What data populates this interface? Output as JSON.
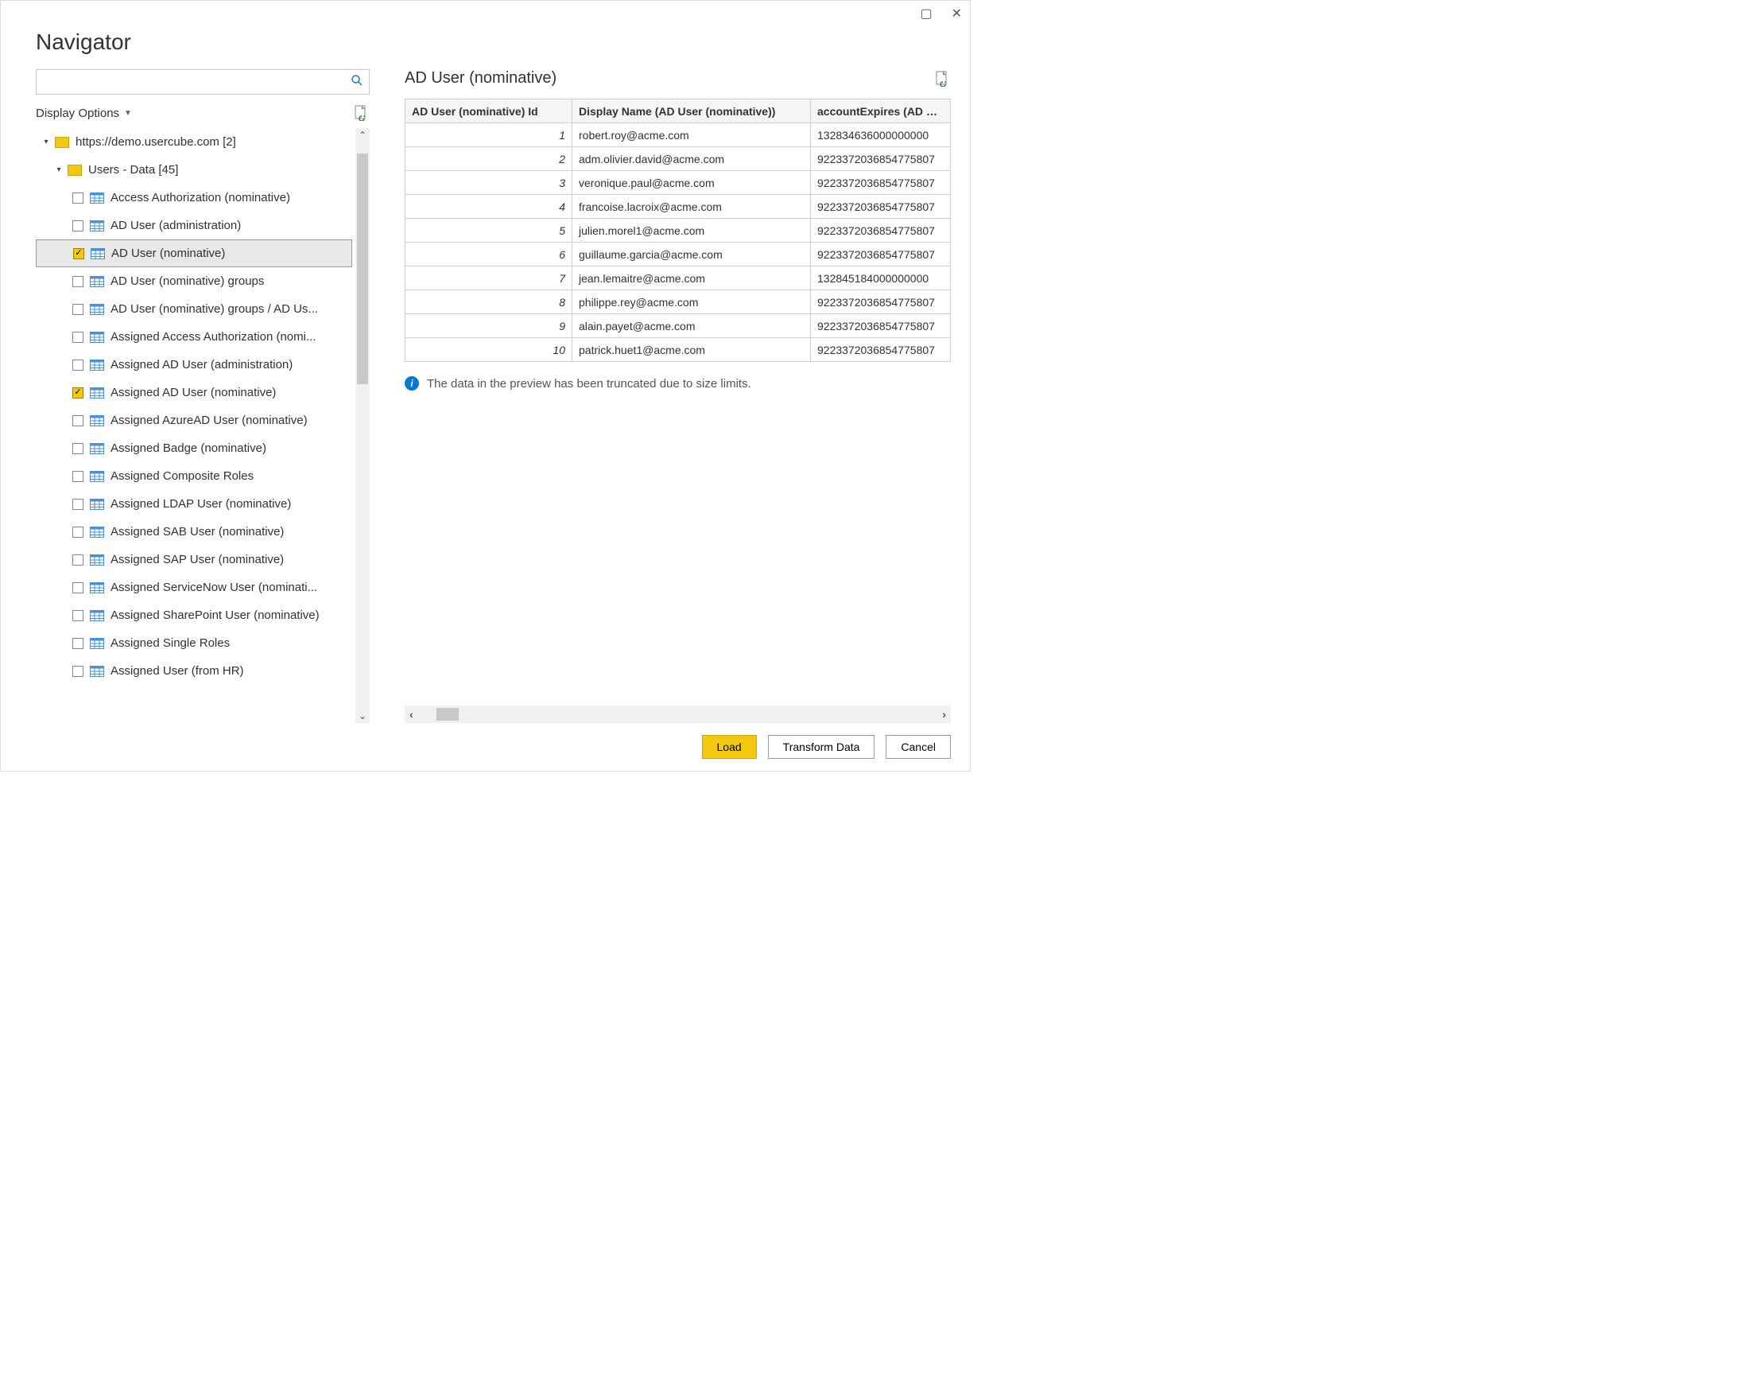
{
  "window": {
    "title": "Navigator"
  },
  "search": {
    "placeholder": ""
  },
  "displayOptions": {
    "label": "Display Options"
  },
  "tree": {
    "root": {
      "label": "https://demo.usercube.com [2]"
    },
    "group": {
      "label": "Users - Data [45]"
    },
    "items": [
      {
        "label": "Access Authorization (nominative)",
        "checked": false,
        "selected": false
      },
      {
        "label": "AD User (administration)",
        "checked": false,
        "selected": false
      },
      {
        "label": "AD User (nominative)",
        "checked": true,
        "selected": true
      },
      {
        "label": "AD User (nominative) groups",
        "checked": false,
        "selected": false
      },
      {
        "label": "AD User (nominative) groups / AD Us...",
        "checked": false,
        "selected": false
      },
      {
        "label": "Assigned Access Authorization (nomi...",
        "checked": false,
        "selected": false
      },
      {
        "label": "Assigned AD User (administration)",
        "checked": false,
        "selected": false
      },
      {
        "label": "Assigned AD User (nominative)",
        "checked": true,
        "selected": false
      },
      {
        "label": "Assigned AzureAD User (nominative)",
        "checked": false,
        "selected": false
      },
      {
        "label": "Assigned Badge (nominative)",
        "checked": false,
        "selected": false
      },
      {
        "label": "Assigned Composite Roles",
        "checked": false,
        "selected": false
      },
      {
        "label": "Assigned LDAP User (nominative)",
        "checked": false,
        "selected": false
      },
      {
        "label": "Assigned SAB User (nominative)",
        "checked": false,
        "selected": false
      },
      {
        "label": "Assigned SAP User (nominative)",
        "checked": false,
        "selected": false
      },
      {
        "label": "Assigned ServiceNow User (nominati...",
        "checked": false,
        "selected": false
      },
      {
        "label": "Assigned SharePoint User (nominative)",
        "checked": false,
        "selected": false
      },
      {
        "label": "Assigned Single Roles",
        "checked": false,
        "selected": false
      },
      {
        "label": "Assigned User (from HR)",
        "checked": false,
        "selected": false
      }
    ]
  },
  "preview": {
    "title": "AD User (nominative)",
    "columns": [
      "AD User (nominative) Id",
      "Display Name (AD User (nominative))",
      "accountExpires (AD Use"
    ],
    "rows": [
      {
        "id": "1",
        "name": "robert.roy@acme.com",
        "exp": "132834636000000000"
      },
      {
        "id": "2",
        "name": "adm.olivier.david@acme.com",
        "exp": "9223372036854775807"
      },
      {
        "id": "3",
        "name": "veronique.paul@acme.com",
        "exp": "9223372036854775807"
      },
      {
        "id": "4",
        "name": "francoise.lacroix@acme.com",
        "exp": "9223372036854775807"
      },
      {
        "id": "5",
        "name": "julien.morel1@acme.com",
        "exp": "9223372036854775807"
      },
      {
        "id": "6",
        "name": "guillaume.garcia@acme.com",
        "exp": "9223372036854775807"
      },
      {
        "id": "7",
        "name": "jean.lemaitre@acme.com",
        "exp": "132845184000000000"
      },
      {
        "id": "8",
        "name": "philippe.rey@acme.com",
        "exp": "9223372036854775807"
      },
      {
        "id": "9",
        "name": "alain.payet@acme.com",
        "exp": "9223372036854775807"
      },
      {
        "id": "10",
        "name": "patrick.huet1@acme.com",
        "exp": "9223372036854775807"
      }
    ],
    "truncated_message": "The data in the preview has been truncated due to size limits."
  },
  "buttons": {
    "load": "Load",
    "transform": "Transform Data",
    "cancel": "Cancel"
  }
}
